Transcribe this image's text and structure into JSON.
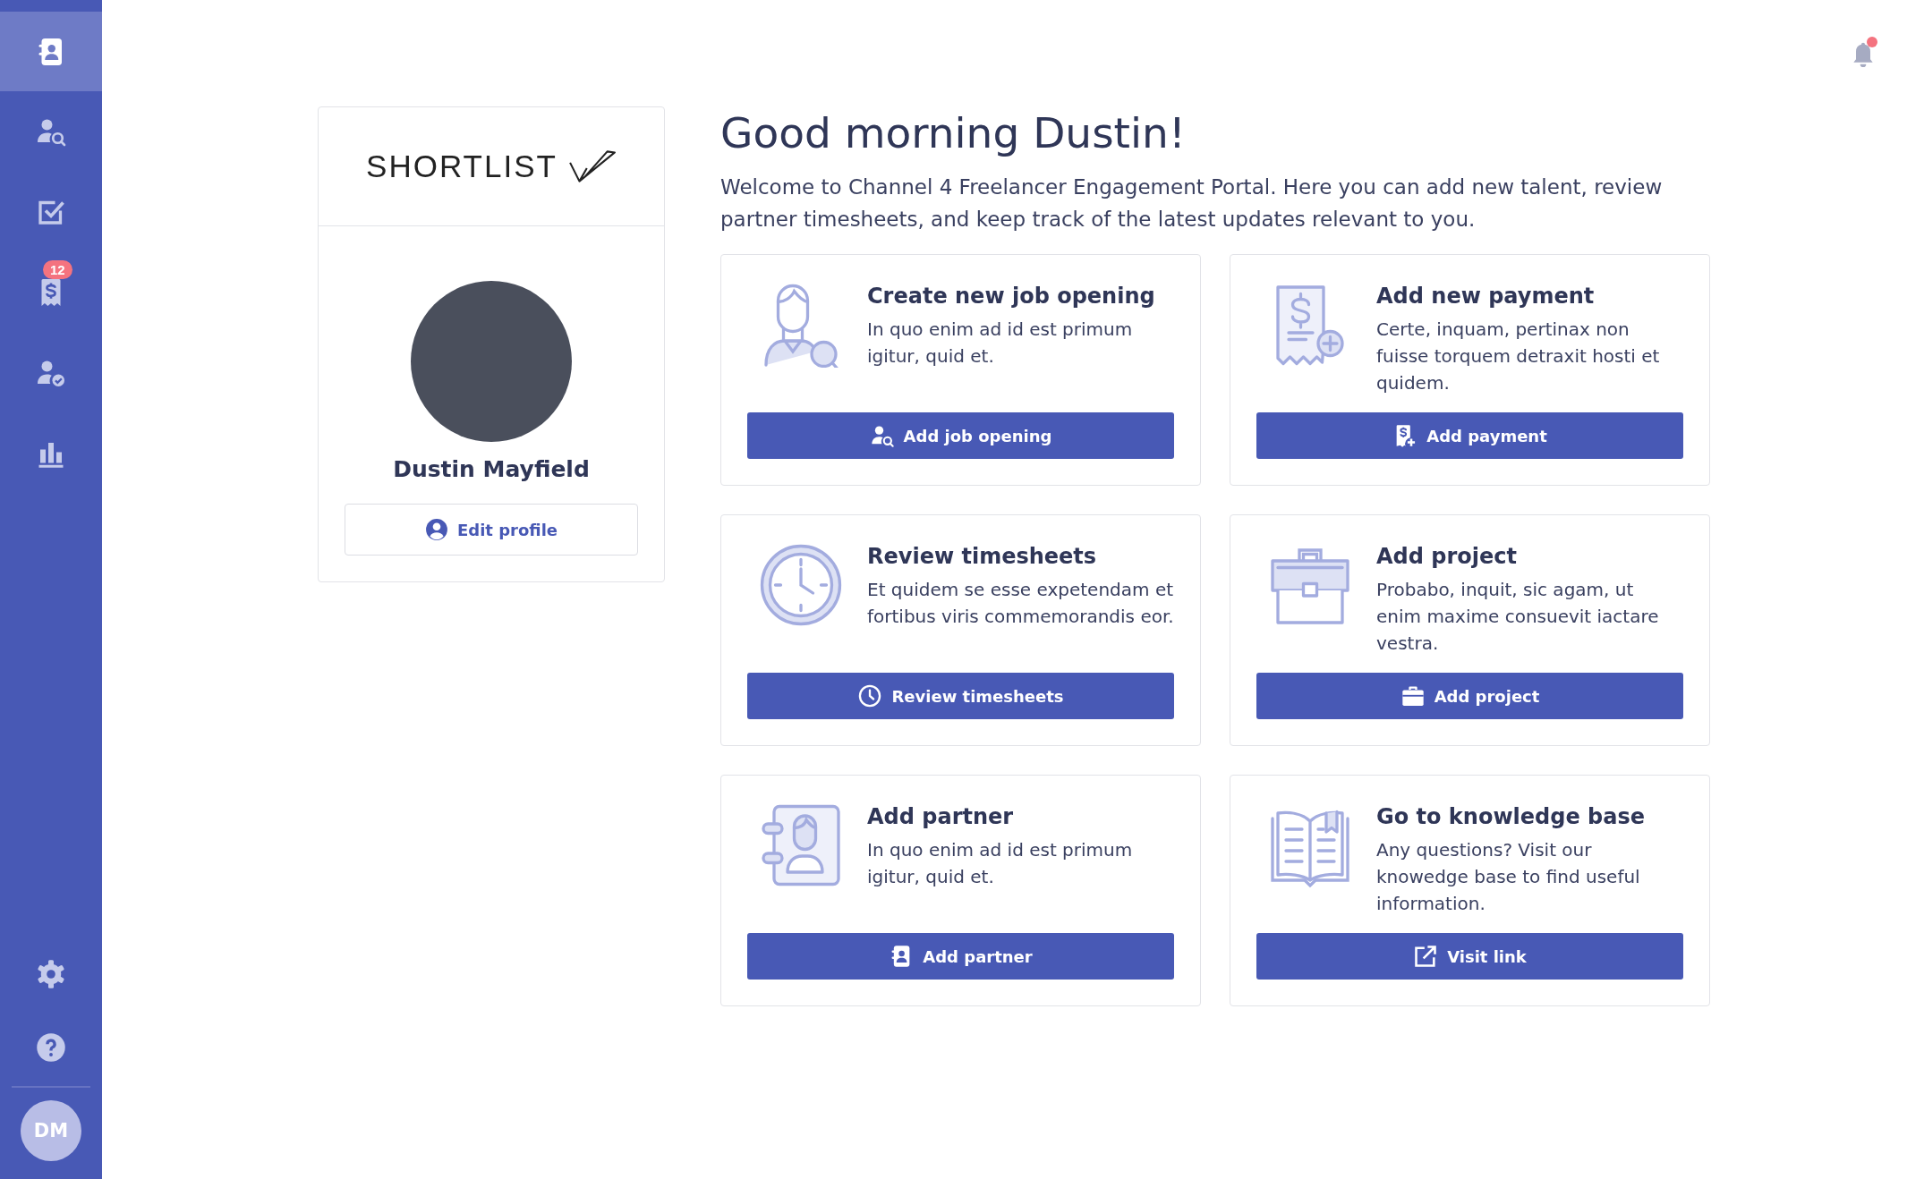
{
  "sidebar": {
    "items": [
      {
        "kind": "contacts",
        "selected": true
      },
      {
        "kind": "person-search",
        "selected": false
      },
      {
        "kind": "tasks",
        "selected": false
      },
      {
        "kind": "payments",
        "selected": false,
        "badge": "12"
      },
      {
        "kind": "person-check",
        "selected": false
      },
      {
        "kind": "reports",
        "selected": false
      }
    ],
    "bottom_items": [
      {
        "kind": "settings"
      },
      {
        "kind": "help"
      }
    ],
    "user_initials": "DM"
  },
  "notifications": {
    "unread": true
  },
  "profile": {
    "logo": "SHORTLIST",
    "name": "Dustin Mayfield",
    "edit_button": "Edit profile"
  },
  "greeting": "Good morning Dustin!",
  "intro": "Welcome to Channel 4 Freelancer Engagement Portal. Here you can add new talent, review partner timesheets, and keep track of the latest updates relevant to you.",
  "cards": [
    {
      "kind": "job",
      "title": "Create new job opening",
      "description": "In quo enim ad id est primum igitur, quid et.",
      "button": "Add job opening"
    },
    {
      "kind": "payment",
      "title": "Add new payment",
      "description": "Certe, inquam, pertinax non fuisse torquem detraxit hosti et quidem.",
      "button": "Add payment"
    },
    {
      "kind": "timesheet",
      "title": "Review timesheets",
      "description": "Et quidem se esse expetendam et fortibus viris commemorandis eor.",
      "button": "Review timesheets"
    },
    {
      "kind": "project",
      "title": "Add project",
      "description": "Probabo, inquit, sic agam, ut enim maxime consuevit iactare vestra.",
      "button": "Add project"
    },
    {
      "kind": "partner",
      "title": "Add partner",
      "description": "In quo enim ad id est primum igitur, quid et.",
      "button": "Add partner"
    },
    {
      "kind": "knowledge",
      "title": "Go to knowledge base",
      "description": "Any questions? Visit our knowedge base to find useful information.",
      "button": "Visit link"
    }
  ]
}
